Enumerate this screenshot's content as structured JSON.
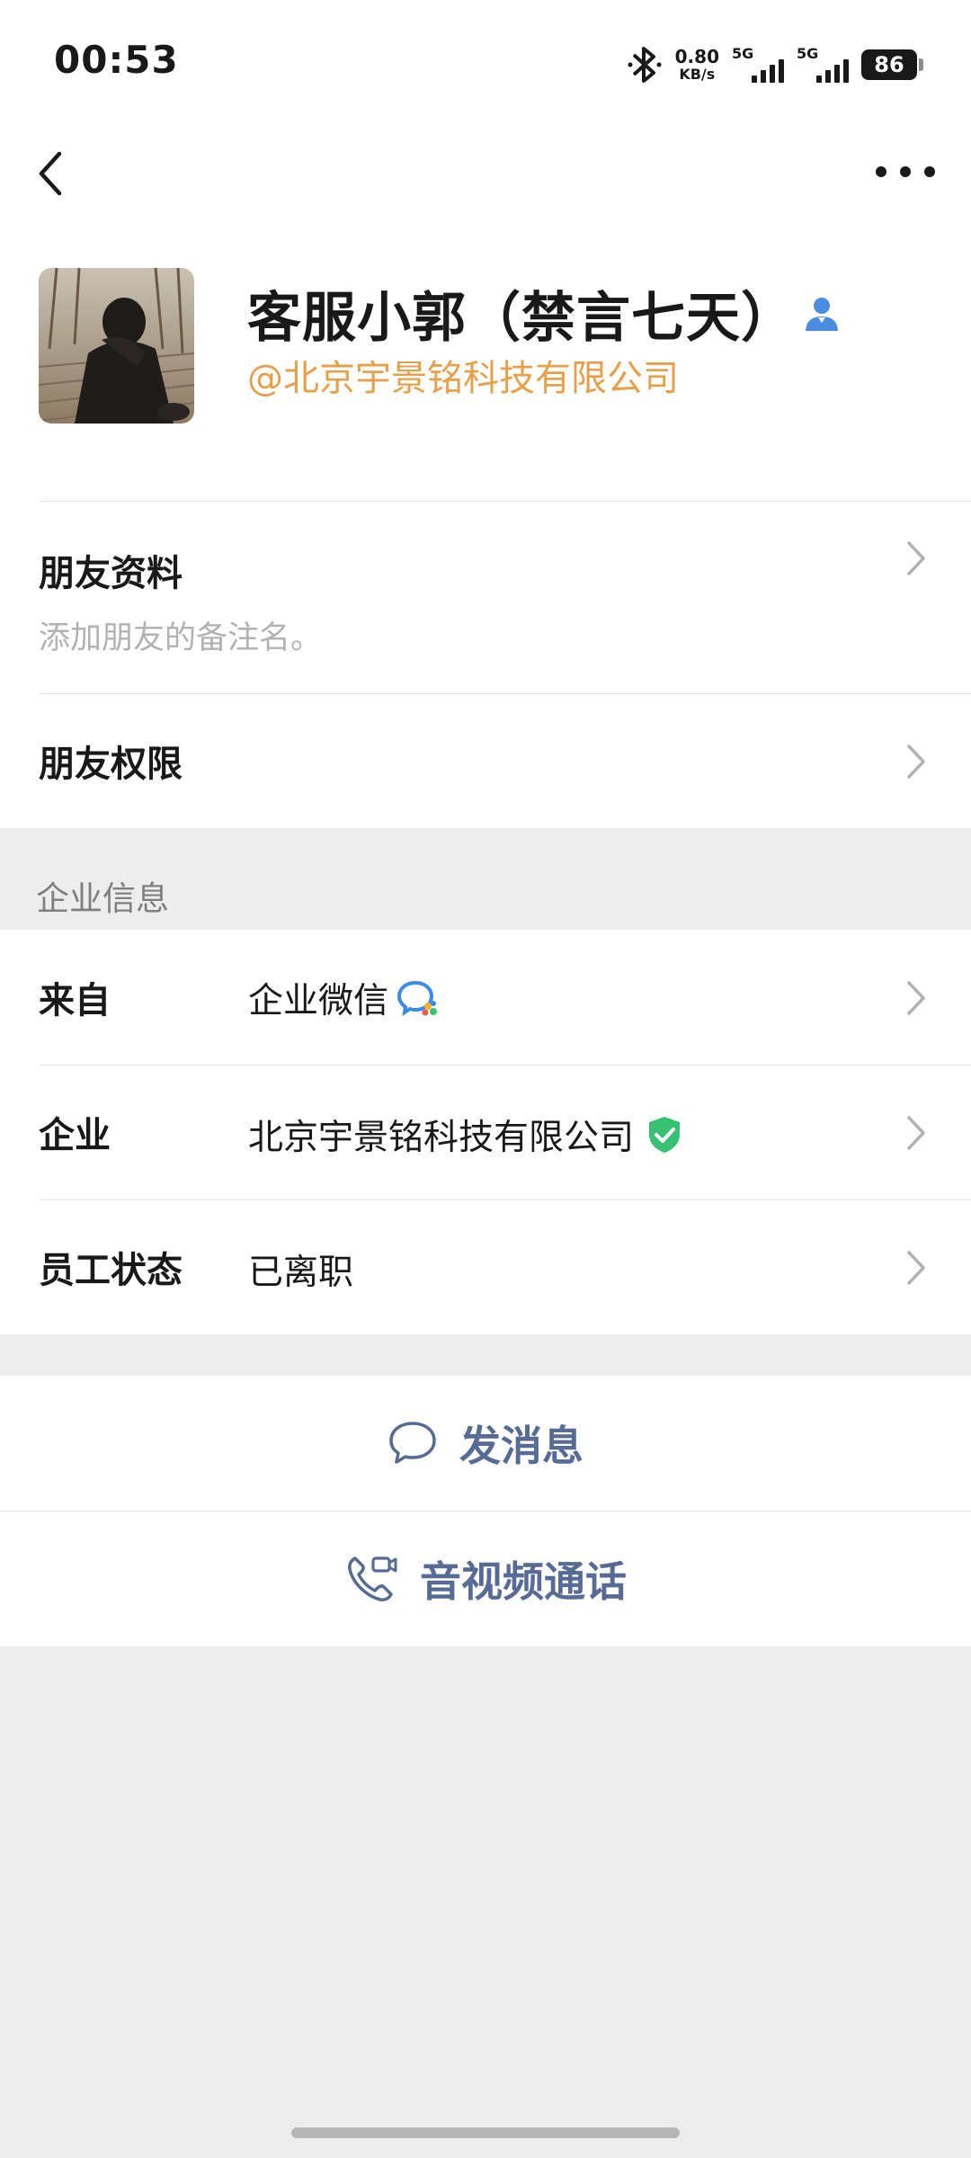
{
  "status_bar": {
    "time": "00:53",
    "net_speed_value": "0.80",
    "net_speed_unit": "KB/s",
    "sim1_label": "5G",
    "sim2_label": "5G",
    "battery": "86"
  },
  "header": {
    "name": "客服小郭（禁言七天）",
    "company_tag": "@北京宇景铭科技有限公司"
  },
  "friend_section": {
    "profile_label": "朋友资料",
    "profile_hint": "添加朋友的备注名。",
    "permissions_label": "朋友权限"
  },
  "enterprise_section": {
    "title": "企业信息",
    "rows": [
      {
        "label": "来自",
        "value": "企业微信",
        "icon": "wecom-logo-icon"
      },
      {
        "label": "企业",
        "value": "北京宇景铭科技有限公司",
        "icon": "verified-shield-icon"
      },
      {
        "label": "员工状态",
        "value": "已离职"
      }
    ]
  },
  "actions": {
    "message_label": "发消息",
    "call_label": "音视频通话"
  },
  "colors": {
    "accent_link": "#576b95",
    "company_tag": "#e6a04b",
    "verified": "#38c172"
  }
}
